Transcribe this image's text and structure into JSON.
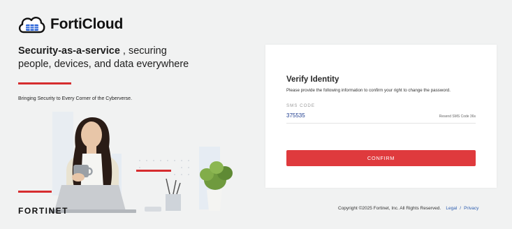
{
  "brand": {
    "logo_text": "FortiCloud",
    "company_wordmark": "FORTINET"
  },
  "hero": {
    "title_bold": "Security-as-a-service",
    "title_rest": " , securing",
    "title_line2": "people, devices, and data everywhere",
    "tagline": "Bringing Security to Every Corner of the Cyberverse."
  },
  "verify": {
    "title": "Verify Identity",
    "description": "Please provide the following information to confirm your right to change the password.",
    "sms_label": "SMS CODE",
    "sms_value": "375535",
    "resend": "Resend SMS Code 36s",
    "confirm_label": "CONFIRM"
  },
  "footer": {
    "copyright": "Copyright ©2025 Fortinet, Inc. All Rights Reserved.",
    "legal": "Legal",
    "separator": "/",
    "privacy": "Privacy"
  },
  "colors": {
    "accent": "#df3a3d",
    "link": "#2f5fb0",
    "value_text": "#1f3d8f"
  }
}
